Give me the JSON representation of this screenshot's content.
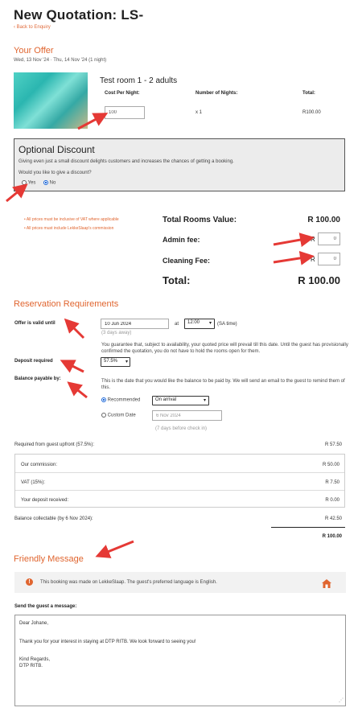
{
  "header": {
    "title": "New Quotation: LS-",
    "back_link": "Back to Enquiry"
  },
  "offer": {
    "section_title": "Your Offer",
    "dates": "Wed, 13 Nov '24 · Thu, 14 Nov '24 (1 night)",
    "room_title": "Test room 1 - 2 adults",
    "col_cost": "Cost Per Night:",
    "col_nights": "Number of Nights:",
    "col_total": "Total:",
    "cost_value": "100",
    "nights_value": "x 1",
    "total_value": "R100.00"
  },
  "discount": {
    "title": "Optional Discount",
    "desc": "Giving even just a small discount delights customers and increases the chances of getting a booking.",
    "question": "Would you like to give a discount?",
    "yes_label": "Yes",
    "no_label": "No",
    "selected": "No"
  },
  "notes": [
    "All prices must be inclusive of VAT where applicable",
    "All prices must include LekkeSlaap's commission"
  ],
  "totals": {
    "rooms_label": "Total Rooms Value:",
    "rooms_value": "R 100.00",
    "admin_label": "Admin fee:",
    "admin_currency": "R",
    "admin_value": "0",
    "cleaning_label": "Cleaning Fee:",
    "cleaning_currency": "R",
    "cleaning_value": "0",
    "total_label": "Total:",
    "total_value": "R 100.00"
  },
  "requirements": {
    "section_title": "Reservation Requirements",
    "valid_label": "Offer is valid until",
    "valid_date": "10 Jun 2024",
    "at_label": "at",
    "time_value": "12:00",
    "time_zone": "(SA time)",
    "days_away": "(3 days away)",
    "guarantee_text": "You guarantee that, subject to availability, your quoted price will prevail till this date. Until the guest has provisionally confirmed the quotation, you do not have to hold the rooms open for them.",
    "deposit_label": "Deposit required",
    "deposit_value": "57.5%",
    "balance_label": "Balance payable by:",
    "balance_desc": "This is the date that you would like the balance to be paid by. We will send an email to the guest to remind them of this.",
    "recommended_label": "Recommended",
    "recommended_option": "On arrival",
    "custom_label": "Custom Date",
    "custom_date": "6 Nov 2024",
    "custom_note": "(7 days before check in)"
  },
  "breakdown": {
    "upfront_label": "Required from guest upfront (57.5%):",
    "upfront_value": "R 57.50",
    "commission_label": "Our commission:",
    "commission_value": "R 50.00",
    "vat_label": "VAT (15%):",
    "vat_value": "R 7.50",
    "deposit_received_label": "Your deposit received:",
    "deposit_received_value": "R 0.00",
    "balance_label": "Balance collectable (by 6 Nov 2024):",
    "balance_value": "R 42.50",
    "final_value": "R 100.00"
  },
  "message": {
    "section_title": "Friendly Message",
    "info_text": "This booking was made on LekkeSlaap. The guest's preferred language is English.",
    "send_label": "Send the guest a message:",
    "body_line1": "Dear Johane,",
    "body_line2": "Thank you for your interest in staying at DTP RITB. We look forward to seeing you!",
    "body_line3": "Kind Regards,",
    "body_line4": "DTP RITB."
  },
  "colors": {
    "accent": "#e0652f",
    "arrow": "#e53935",
    "discount_bg": "#ececec",
    "info_bg": "#f2f2f2"
  }
}
